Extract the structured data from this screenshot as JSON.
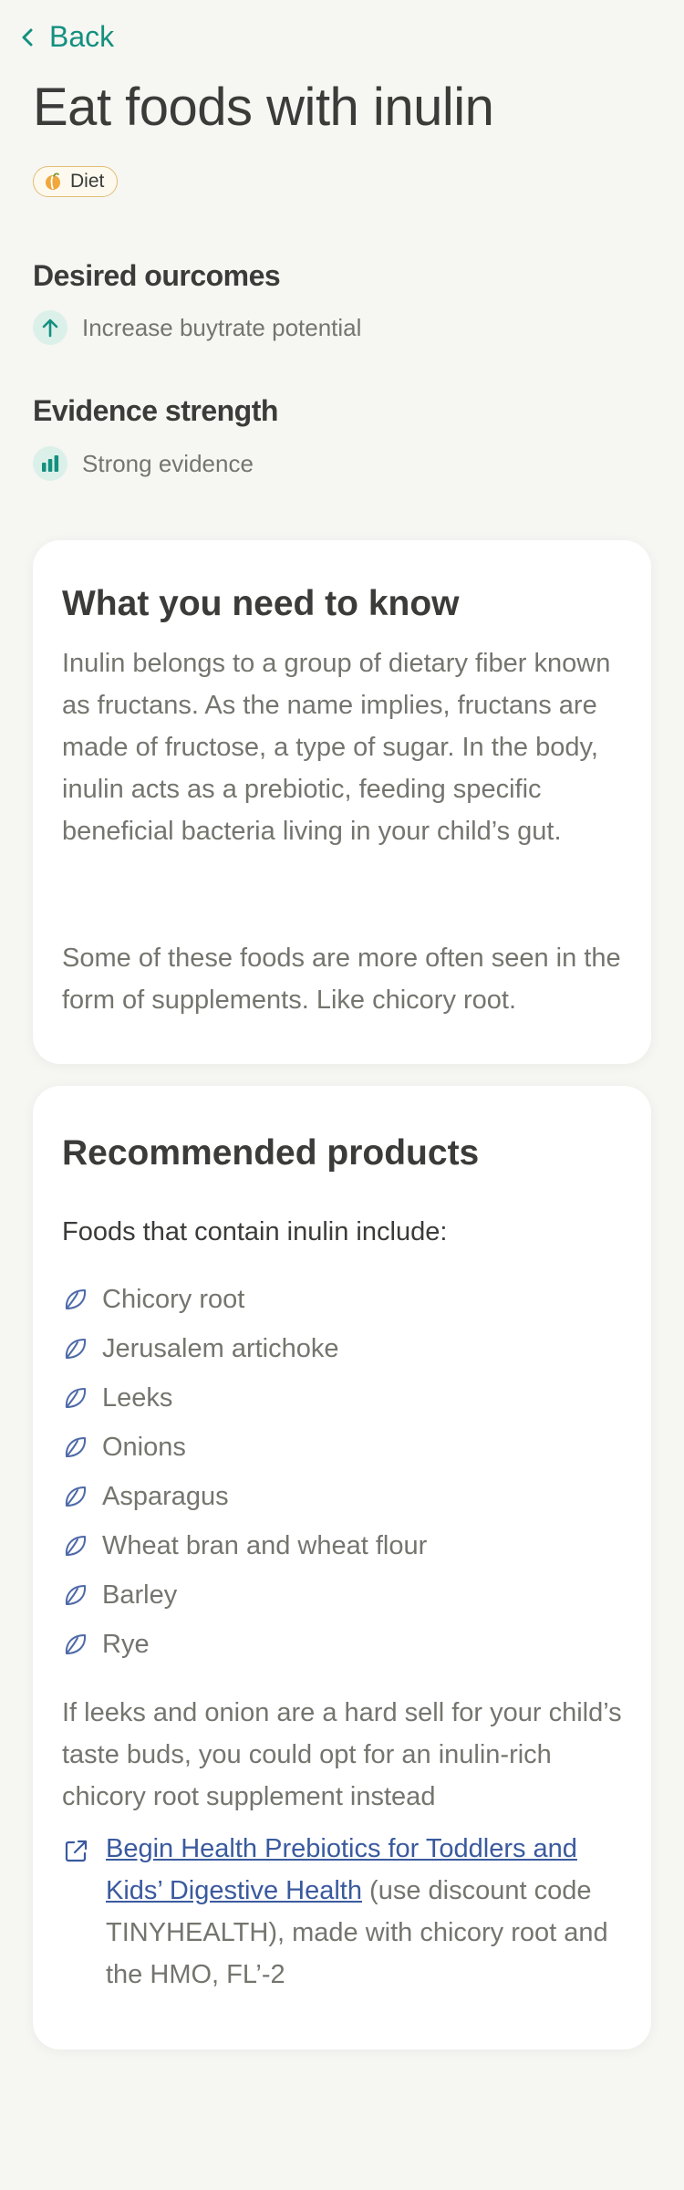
{
  "nav": {
    "back_label": "Back"
  },
  "page": {
    "title": "Eat foods with inulin",
    "tag": "Diet"
  },
  "outcomes": {
    "heading": "Desired ourcomes",
    "item": "Increase buytrate potential"
  },
  "evidence": {
    "heading": "Evidence strength",
    "item": "Strong evidence"
  },
  "know": {
    "heading": "What you need to know",
    "paragraph1": "Inulin belongs to a group of dietary fiber known as fructans. As the name implies, fructans are made of fructose, a type of sugar. In the body, inulin acts as a prebiotic, feeding specific beneficial bacteria living in your child’s gut.",
    "paragraph2": "Some of these foods are more often seen in the form of supplements. Like chicory root."
  },
  "products": {
    "heading": "Recommended products",
    "lead": "Foods that contain inulin include:",
    "foods": [
      "Chicory root",
      "Jerusalem artichoke",
      "Leeks",
      "Onions",
      "Asparagus",
      "Wheat bran and wheat flour",
      "Barley",
      "Rye"
    ],
    "note": "If leeks and onion are a hard sell for your child’s taste buds, you could opt for an inulin-rich chicory root supplement instead",
    "link_text": "Begin Health Prebiotics for Toddlers and Kids’ Digestive Health",
    "link_suffix": " (use discount code TINYHEALTH), made with chicory root and the HMO, FL’-2"
  },
  "colors": {
    "accent": "#14907f",
    "link": "#3a5a9e",
    "tag_border": "#e2bd72",
    "background": "#f6f6f3"
  },
  "icons": {
    "back": "chevron-left-icon",
    "tag": "diet-icon",
    "outcome": "arrow-up-icon",
    "evidence": "signal-bars-icon",
    "food": "leaf-icon",
    "link": "external-link-icon"
  }
}
